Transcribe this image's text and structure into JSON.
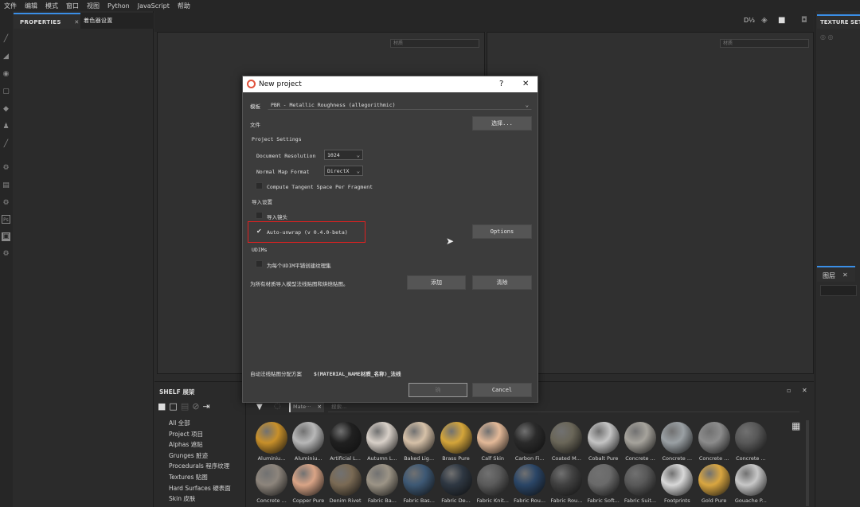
{
  "menubar": [
    "文件",
    "编辑",
    "模式",
    "窗口",
    "视图",
    "Python",
    "JavaScript",
    "帮助"
  ],
  "properties": {
    "tab_properties": "PROPERTIES",
    "tab_close": "✕",
    "tab_shader": "着色器设置"
  },
  "viewports": {
    "left_material_placeholder": "材质",
    "right_material_placeholder": "材质"
  },
  "toptools": {
    "d_label": "D⅓"
  },
  "texture_set": {
    "title": "TEXTURE SET"
  },
  "layers": {
    "title": "图层",
    "close": "✕"
  },
  "dialog": {
    "title": "New project",
    "help": "?",
    "close": "✕",
    "template_label": "模板",
    "template_value": "PBR - Metallic Roughness (allegorithmic)",
    "file_label": "文件",
    "select_button": "选择...",
    "project_settings": "Project Settings",
    "doc_res_label": "Document Resolution",
    "doc_res_value": "1024",
    "normal_map_label": "Normal Map Format",
    "normal_map_value": "DirectX",
    "compute_tangent_label": "Compute Tangent Space Per Fragment",
    "compute_tangent_checked": false,
    "import_settings": "导入设置",
    "import_cameras_label": "导入镜头",
    "import_cameras_checked": false,
    "auto_unwrap_label": "Auto-unwrap (v 0.4.0-beta)",
    "auto_unwrap_checked": true,
    "options_button": "Options",
    "udims": "UDIMs",
    "udim_label": "为每个UDIM平铺创建纹理集",
    "udim_checked": false,
    "add_maps_label": "为所有材质导入模型法线贴图和烘焙贴图。",
    "add_button": "添加",
    "clear_button": "清除",
    "auto_normal_label": "自动法线贴图分配方案",
    "auto_normal_value": "$(MATERIAL_NAME材质_名称)_法线",
    "ok_button": "确",
    "cancel_button": "Cancel"
  },
  "shelf": {
    "title": "SHELF 展架",
    "categories": [
      "All 全部",
      "Project 项目",
      "Alphas 遮贴",
      "Grunges 脏迹",
      "Procedurals 程序纹理",
      "Textures 贴图",
      "Hard Surfaces 硬表面",
      "Skin 皮肤"
    ],
    "filter_tag": "Mate···",
    "filter_close": "✕",
    "search_placeholder": "搜索...",
    "row1": [
      {
        "label": "Aluminiu...",
        "color": "#c8902a"
      },
      {
        "label": "Aluminiu...",
        "color": "#b8b8b8"
      },
      {
        "label": "Artificial L...",
        "color": "#202020"
      },
      {
        "label": "Autumn L...",
        "color": "#d8d0c8"
      },
      {
        "label": "Baked Lig...",
        "color": "#d6c1a8"
      },
      {
        "label": "Brass Pure",
        "color": "#d4a53a"
      },
      {
        "label": "Calf Skin",
        "color": "#e3b998"
      },
      {
        "label": "Carbon Fi...",
        "color": "#2a2a2a"
      },
      {
        "label": "Coated M...",
        "color": "#6a6658"
      },
      {
        "label": "Cobalt Pure",
        "color": "#c4c4c4"
      },
      {
        "label": "Concrete ...",
        "color": "#a6a39c"
      },
      {
        "label": "Concrete ...",
        "color": "#9aa0a4"
      },
      {
        "label": "Concrete ...",
        "color": "#8c8c8c"
      },
      {
        "label": "Concrete ...",
        "color": "#585858"
      }
    ],
    "row2": [
      {
        "label": "Concrete ...",
        "color": "#8d857c"
      },
      {
        "label": "Copper Pure",
        "color": "#d9a486"
      },
      {
        "label": "Denim Rivet",
        "color": "#7a6a54"
      },
      {
        "label": "Fabric Ba...",
        "color": "#9c9486"
      },
      {
        "label": "Fabric Bas...",
        "color": "#3d5874"
      },
      {
        "label": "Fabric De...",
        "color": "#2e3742"
      },
      {
        "label": "Fabric Knit...",
        "color": "#5a5a5a"
      },
      {
        "label": "Fabric Rou...",
        "color": "#2a4566"
      },
      {
        "label": "Fabric Rou...",
        "color": "#404040"
      },
      {
        "label": "Fabric Soft...",
        "color": "#6a6a6a"
      },
      {
        "label": "Fabric Suit...",
        "color": "#585858"
      },
      {
        "label": "Footprints",
        "color": "#d8d8d8"
      },
      {
        "label": "Gold Pure",
        "color": "#d9a640"
      },
      {
        "label": "Gouache P...",
        "color": "#c8c8c8"
      }
    ]
  }
}
